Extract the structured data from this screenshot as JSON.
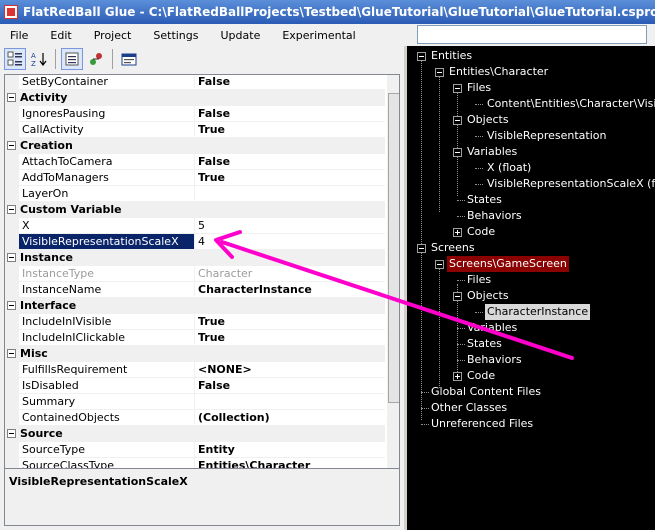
{
  "window": {
    "title": "FlatRedBall Glue - C:\\FlatRedBallProjects\\Testbed\\GlueTutorial\\GlueTutorial\\GlueTutorial.csproj"
  },
  "menu": [
    "File",
    "Edit",
    "Project",
    "Settings",
    "Update",
    "Experimental"
  ],
  "search": {
    "value": ""
  },
  "property_grid": {
    "first_row": {
      "name": "SetByContainer",
      "value": "False"
    },
    "categories": [
      {
        "name": "Activity",
        "rows": [
          {
            "name": "IgnoresPausing",
            "value": "False"
          },
          {
            "name": "CallActivity",
            "value": "True"
          }
        ]
      },
      {
        "name": "Creation",
        "rows": [
          {
            "name": "AttachToCamera",
            "value": "False"
          },
          {
            "name": "AddToManagers",
            "value": "True"
          },
          {
            "name": "LayerOn",
            "value": ""
          }
        ]
      },
      {
        "name": "Custom Variable",
        "rows": [
          {
            "name": "X",
            "value": "5"
          },
          {
            "name": "VisibleRepresentationScaleX",
            "value": "4"
          }
        ]
      },
      {
        "name": "Instance",
        "rows": [
          {
            "name": "InstanceType",
            "value": "Character"
          },
          {
            "name": "InstanceName",
            "value": "CharacterInstance"
          }
        ]
      },
      {
        "name": "Interface",
        "rows": [
          {
            "name": "IncludeInIVisible",
            "value": "True"
          },
          {
            "name": "IncludeInIClickable",
            "value": "True"
          }
        ]
      },
      {
        "name": "Misc",
        "rows": [
          {
            "name": "FulfillsRequirement",
            "value": "<NONE>"
          },
          {
            "name": "IsDisabled",
            "value": "False"
          },
          {
            "name": "Summary",
            "value": ""
          },
          {
            "name": "ContainedObjects",
            "value": "(Collection)"
          }
        ]
      },
      {
        "name": "Source",
        "rows": [
          {
            "name": "SourceType",
            "value": "Entity"
          },
          {
            "name": "SourceClassType",
            "value": "Entities\\Character"
          }
        ]
      }
    ],
    "help_text": "VisibleRepresentationScaleX"
  },
  "tree": [
    {
      "label": "Entities",
      "level": 0
    },
    {
      "label": "Entities\\Character",
      "level": 1
    },
    {
      "label": "Files",
      "level": 2
    },
    {
      "label": "Content\\Entities\\Character\\VisibleRepresentation.scnx",
      "level": 3
    },
    {
      "label": "Objects",
      "level": 2
    },
    {
      "label": "VisibleRepresentation",
      "level": 3
    },
    {
      "label": "Variables",
      "level": 2
    },
    {
      "label": "X (float)",
      "level": 3
    },
    {
      "label": "VisibleRepresentationScaleX (float)",
      "level": 3
    },
    {
      "label": "States",
      "level": 2
    },
    {
      "label": "Behaviors",
      "level": 2
    },
    {
      "label": "Code",
      "level": 2
    },
    {
      "label": "Screens",
      "level": 0
    },
    {
      "label": "Screens\\GameScreen",
      "level": 1
    },
    {
      "label": "Files",
      "level": 2
    },
    {
      "label": "Objects",
      "level": 2
    },
    {
      "label": "CharacterInstance",
      "level": 3
    },
    {
      "label": "Variables",
      "level": 2
    },
    {
      "label": "States",
      "level": 2
    },
    {
      "label": "Behaviors",
      "level": 2
    },
    {
      "label": "Code",
      "level": 2
    },
    {
      "label": "Global Content Files",
      "level": 0
    },
    {
      "label": "Other Classes",
      "level": 0
    },
    {
      "label": "Unreferenced Files",
      "level": 0
    }
  ],
  "colors": {
    "tree_highlight": "#8b0000",
    "annotation_arrow": "#ff00cc",
    "selection": "#0a246a"
  }
}
